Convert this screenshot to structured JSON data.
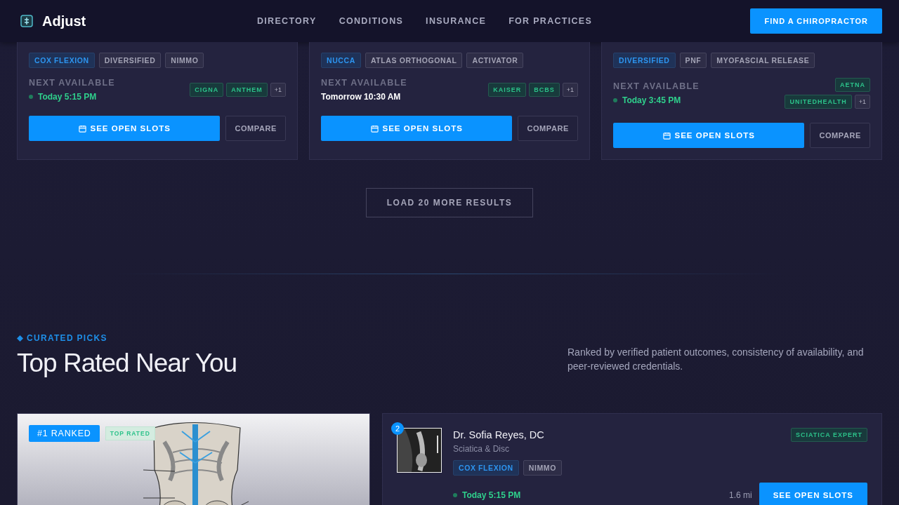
{
  "header": {
    "brand": "Adjust",
    "nav": [
      "DIRECTORY",
      "CONDITIONS",
      "INSURANCE",
      "FOR PRACTICES"
    ],
    "cta": "FIND A CHIROPRACTOR"
  },
  "results": [
    {
      "techniques": [
        {
          "label": "COX FLEXION",
          "primary": true
        },
        {
          "label": "DIVERSIFIED",
          "primary": false
        },
        {
          "label": "NIMMO",
          "primary": false
        }
      ],
      "availability_label": "NEXT AVAILABLE",
      "availability": "Today 5:15 PM",
      "soon": true,
      "insurance": [
        "CIGNA",
        "ANTHEM"
      ],
      "more": "+1",
      "book": "SEE OPEN SLOTS",
      "compare": "COMPARE"
    },
    {
      "techniques": [
        {
          "label": "NUCCA",
          "primary": true
        },
        {
          "label": "ATLAS ORTHOGONAL",
          "primary": false
        },
        {
          "label": "ACTIVATOR",
          "primary": false
        }
      ],
      "availability_label": "NEXT AVAILABLE",
      "availability": "Tomorrow 10:30 AM",
      "soon": false,
      "insurance": [
        "KAISER",
        "BCBS"
      ],
      "more": "+1",
      "book": "SEE OPEN SLOTS",
      "compare": "COMPARE"
    },
    {
      "techniques": [
        {
          "label": "DIVERSIFIED",
          "primary": true
        },
        {
          "label": "PNF",
          "primary": false
        },
        {
          "label": "MYOFASCIAL RELEASE",
          "primary": false
        }
      ],
      "availability_label": "NEXT AVAILABLE",
      "availability": "Today 3:45 PM",
      "soon": true,
      "insurance": [
        "AETNA",
        "UNITEDHEALTH"
      ],
      "more": "+1",
      "book": "SEE OPEN SLOTS",
      "compare": "COMPARE"
    }
  ],
  "load_more": "LOAD 20 MORE RESULTS",
  "curated": {
    "eyebrow": "CURATED PICKS",
    "title": "Top Rated Near You",
    "description": "Ranked by verified patient outcomes, consistency of availability, and peer-reviewed credentials.",
    "featured": {
      "rank": "#1 RANKED",
      "badge": "TOP RATED"
    },
    "listing": {
      "rank": "2",
      "name": "Dr. Sofia Reyes, DC",
      "specialty": "Sciatica & Disc",
      "badge": "SCIATICA EXPERT",
      "techniques": [
        {
          "label": "COX FLEXION",
          "primary": true
        },
        {
          "label": "NIMMO",
          "primary": false
        }
      ],
      "availability": "Today 5:15 PM",
      "soon": true,
      "distance": "1.6 mi",
      "book": "SEE OPEN SLOTS"
    }
  }
}
